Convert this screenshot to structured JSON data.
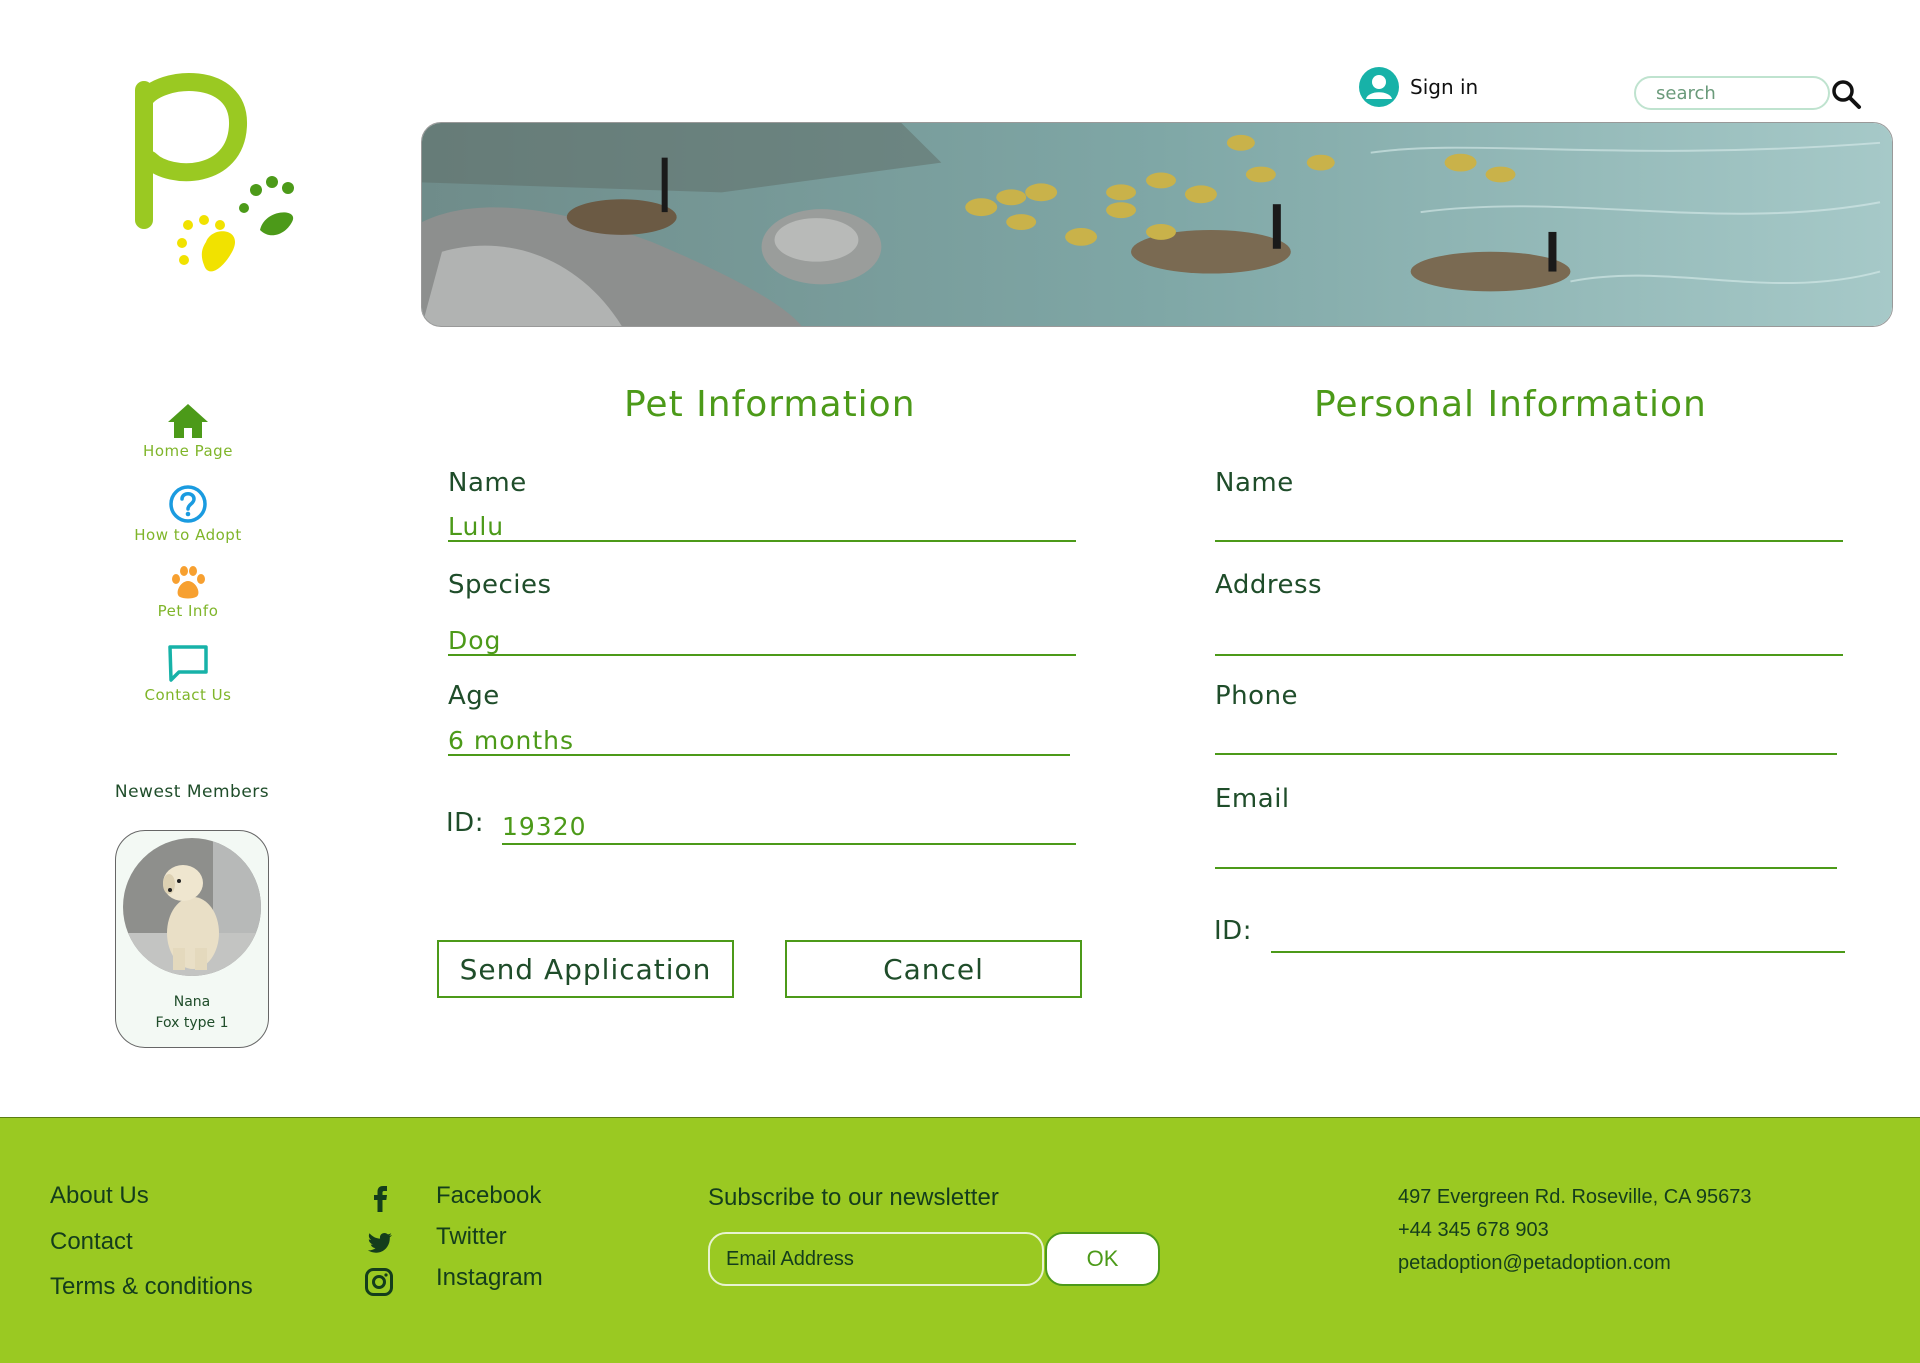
{
  "header": {
    "signin_label": "Sign in",
    "search_placeholder": "search"
  },
  "nav": {
    "items": [
      {
        "label": "Home Page",
        "icon": "home-icon",
        "color": "#4c9a19"
      },
      {
        "label": "How to Adopt",
        "icon": "question-icon",
        "color": "#1a9be0"
      },
      {
        "label": "Pet Info",
        "icon": "paw-icon",
        "color": "#f7a030"
      },
      {
        "label": "Contact Us",
        "icon": "chat-icon",
        "color": "#17b2a8"
      }
    ]
  },
  "members": {
    "title": "Newest Members",
    "cards": [
      {
        "name": "Nana",
        "type": "Fox type 1"
      }
    ]
  },
  "pet_form": {
    "title": "Pet Information",
    "name_label": "Name",
    "name_value": "Lulu",
    "species_label": "Species",
    "species_value": "Dog",
    "age_label": "Age",
    "age_value": "6 months",
    "id_label": "ID:",
    "id_value": "19320",
    "send_label": "Send Application",
    "cancel_label": "Cancel"
  },
  "personal_form": {
    "title": "Personal Information",
    "name_label": "Name",
    "address_label": "Address",
    "phone_label": "Phone",
    "email_label": "Email",
    "id_label": "ID:"
  },
  "footer": {
    "links": [
      "About Us",
      "Contact",
      "Terms & conditions"
    ],
    "social": [
      {
        "label": "Facebook",
        "icon": "facebook-icon"
      },
      {
        "label": "Twitter",
        "icon": "twitter-icon"
      },
      {
        "label": "Instagram",
        "icon": "instagram-icon"
      }
    ],
    "newsletter_title": "Subscribe to our newsletter",
    "email_placeholder": "Email Address",
    "ok_label": "OK",
    "address": "497 Evergreen Rd. Roseville, CA 95673",
    "phone": "+44 345 678 903",
    "email": "petadoption@petadoption.com"
  },
  "colors": {
    "brand_green": "#4c9a19",
    "lime": "#9ac922",
    "dark_text": "#1f4d2a"
  }
}
